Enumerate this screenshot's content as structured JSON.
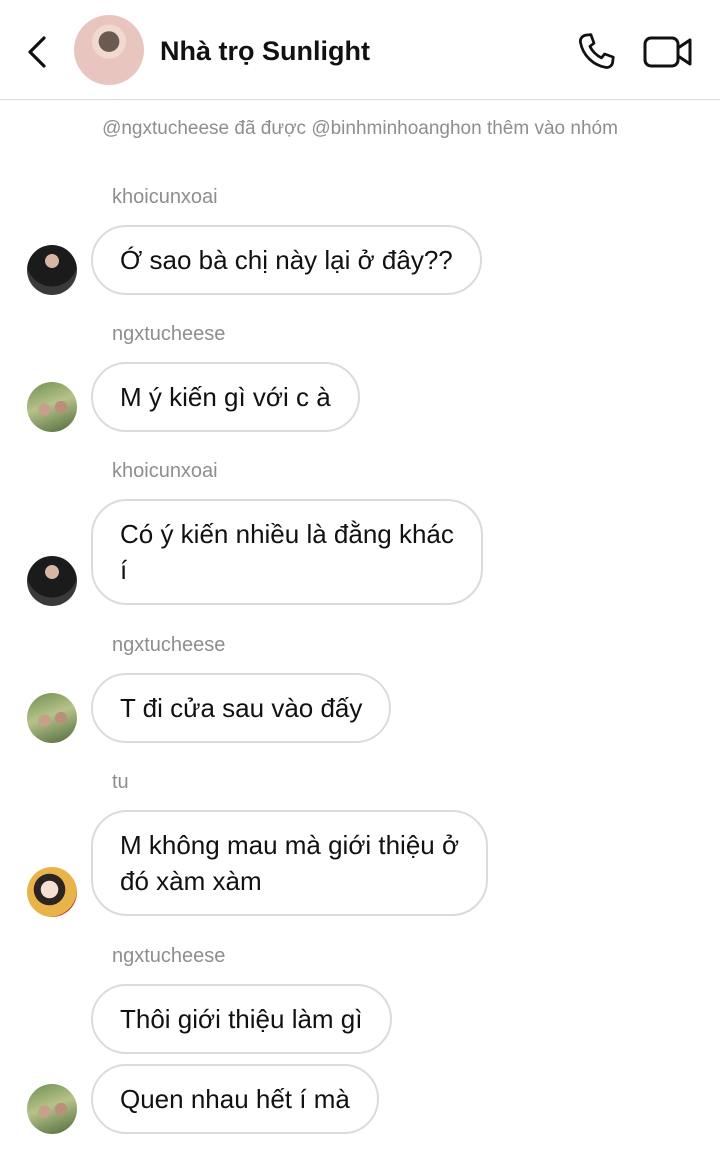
{
  "header": {
    "title": "Nhà trọ Sunlight",
    "back_icon": "chevron-left-icon",
    "call_icon": "phone-icon",
    "video_icon": "video-camera-icon"
  },
  "system_message": "@ngxtucheese đã được @binhminhoanghon thêm vào nhóm",
  "messages": [
    {
      "sender": "khoicunxoai",
      "lines": [
        "Ớ sao bà chị này lại ở đây??"
      ]
    },
    {
      "sender": "ngxtucheese",
      "lines": [
        "M ý kiến gì với c à"
      ]
    },
    {
      "sender": "khoicunxoai",
      "lines": [
        "Có ý kiến nhiều là đằng khác",
        "í"
      ]
    },
    {
      "sender": "ngxtucheese",
      "lines": [
        "T đi cửa sau vào đấy"
      ]
    },
    {
      "sender": "tu",
      "lines": [
        "M không mau mà giới thiệu ở",
        "đó xàm xàm"
      ]
    },
    {
      "sender": "ngxtucheese",
      "lines": [
        "Thôi giới thiệu làm gì"
      ]
    },
    {
      "sender": "",
      "lines": [
        "Quen nhau hết í mà"
      ]
    }
  ]
}
